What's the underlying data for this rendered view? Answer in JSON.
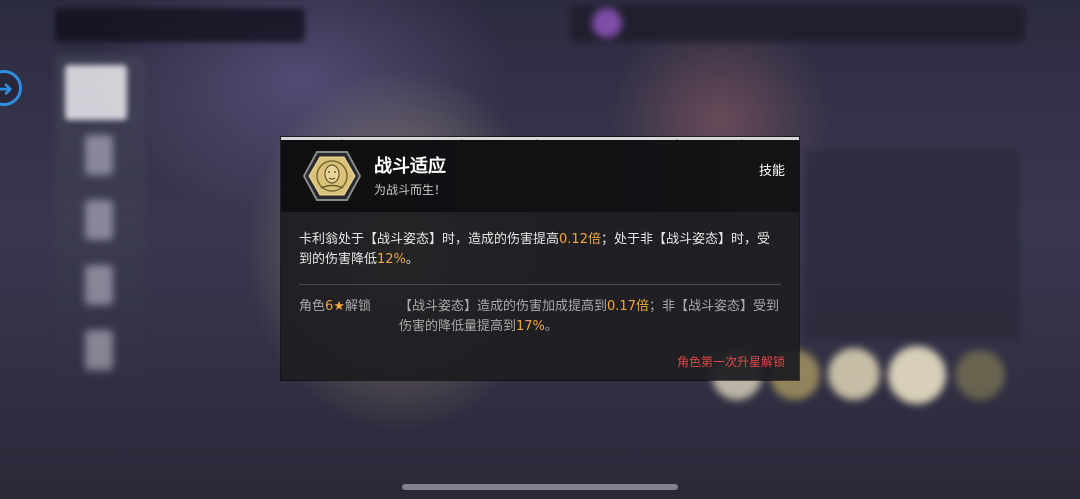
{
  "skill_card": {
    "name": "战斗适应",
    "subtitle": "为战斗而生！",
    "type_label": "技能",
    "description": {
      "p1": "卡利翁处于【战斗姿态】时，造成的伤害提高",
      "v1": "0.12倍",
      "p2": "；处于非【战斗姿态】时，受到的伤害降低",
      "v2": "12%",
      "p3": "。"
    },
    "unlock": {
      "requirement_prefix": "角色",
      "requirement_stars": "6★",
      "requirement_suffix": "解锁",
      "p1": "【战斗姿态】造成的伤害加成提高到",
      "v1": "0.17倍",
      "p2": "；非【战斗姿态】受到伤害的降低量提高到",
      "v2": "17%",
      "p3": "。"
    },
    "footer_note": "角色第一次升星解锁"
  },
  "colors": {
    "highlight": "#f0a63a",
    "footer_note": "#e04545",
    "side_arrow": "#2e8fe0"
  },
  "icons": {
    "skill": "face-portrait-icon",
    "side": "arrow-right-circle-icon"
  }
}
